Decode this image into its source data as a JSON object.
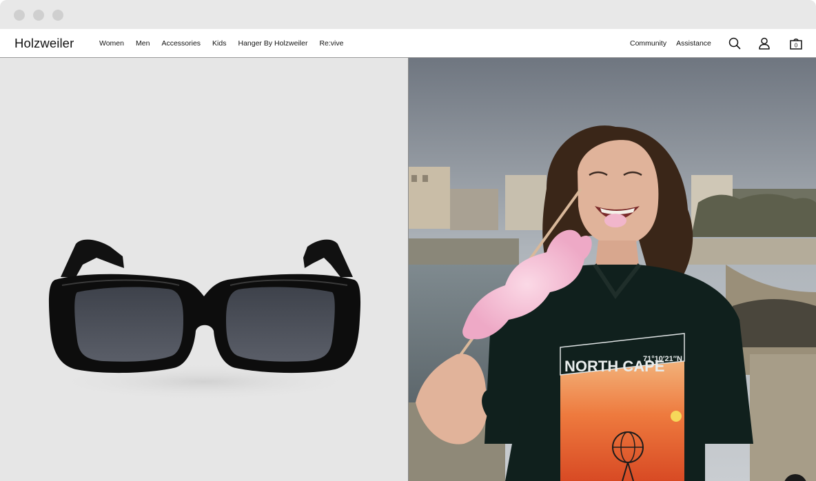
{
  "window": {
    "controls": [
      "close",
      "minimize",
      "maximize"
    ]
  },
  "header": {
    "logo": "Holzweiler",
    "nav_left": [
      "Women",
      "Men",
      "Accessories",
      "Kids",
      "Hanger By Holzweiler",
      "Re:vive"
    ],
    "nav_right": [
      "Community",
      "Assistance"
    ],
    "icons": [
      "search-icon",
      "account-icon",
      "cart-icon"
    ],
    "cart_count": "0"
  },
  "hero": {
    "left_image": "product-sunglasses",
    "right_image": "lifestyle-photo",
    "shirt_text_1": "NORTH CAPE",
    "shirt_text_2": "71°10′21″N"
  },
  "colors": {
    "left_bg": "#e6e6e6",
    "nav_bg": "#ffffff",
    "text": "#111111"
  }
}
